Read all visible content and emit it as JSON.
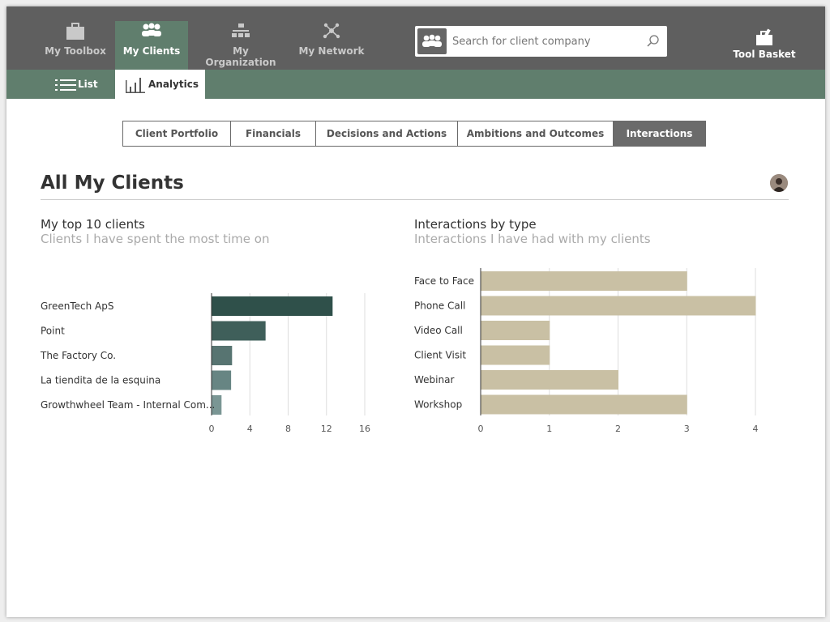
{
  "colors": {
    "topnav_bg": "#5f5f5f",
    "accent_green": "#607e6d",
    "clients_bar_colors": [
      "#2f504a",
      "#3f5f5a",
      "#577471",
      "#678583",
      "#7a9694"
    ],
    "interactions_bar_color": "#c9c0a4",
    "tab_active_bg": "#6b6b6b"
  },
  "nav": {
    "items": [
      {
        "label": "My Toolbox",
        "icon": "toolbox-icon"
      },
      {
        "label": "My Clients",
        "icon": "clients-icon"
      },
      {
        "label": "My Organization",
        "icon": "organization-icon"
      },
      {
        "label": "My Network",
        "icon": "network-icon"
      }
    ],
    "active_index": 1,
    "search": {
      "placeholder": "Search for client company",
      "value": ""
    },
    "tool_basket": {
      "label": "Tool Basket",
      "icon": "tool-basket-icon"
    }
  },
  "subnav": {
    "list_label": "List",
    "analytics_label": "Analytics"
  },
  "tabs": [
    {
      "label": "Client Portfolio"
    },
    {
      "label": "Financials"
    },
    {
      "label": "Decisions and Actions"
    },
    {
      "label": "Ambitions and Outcomes"
    },
    {
      "label": "Interactions"
    }
  ],
  "active_tab_index": 4,
  "page": {
    "title": "All My Clients"
  },
  "panels": {
    "left": {
      "title": "My top 10 clients",
      "subtitle": "Clients I have spent the most time on"
    },
    "right": {
      "title": "Interactions by type",
      "subtitle": "Interactions I have had with my clients"
    }
  },
  "chart_data": [
    {
      "type": "bar",
      "orientation": "horizontal",
      "categories": [
        "GreenTech ApS",
        "Point",
        "The Factory Co.",
        "La tiendita de la esquina",
        "Growthwheel Team - Internal Com..."
      ],
      "values": [
        12.6,
        5.6,
        2.1,
        2.0,
        1.0
      ],
      "xlim": [
        0,
        16
      ],
      "xticks": [
        "0",
        "4",
        "8",
        "12",
        "16"
      ],
      "grid": true
    },
    {
      "type": "bar",
      "orientation": "horizontal",
      "categories": [
        "Face to Face",
        "Phone Call",
        "Video Call",
        "Client Visit",
        "Webinar",
        "Workshop"
      ],
      "values": [
        3,
        4,
        1,
        1,
        2,
        3
      ],
      "xlim": [
        0,
        4
      ],
      "xticks": [
        "0",
        "1",
        "2",
        "3",
        "4"
      ],
      "grid": true
    }
  ]
}
